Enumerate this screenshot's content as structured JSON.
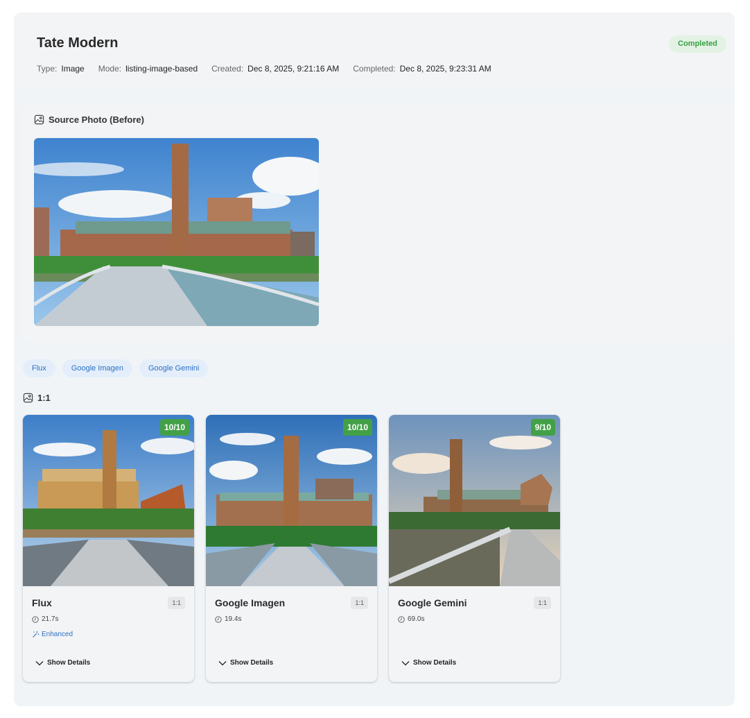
{
  "header": {
    "title": "Tate Modern",
    "status": "Completed",
    "meta": [
      {
        "key": "Type:",
        "value": "Image"
      },
      {
        "key": "Mode:",
        "value": "listing-image-based"
      },
      {
        "key": "Created:",
        "value": "Dec 8, 2025, 9:21:16 AM"
      },
      {
        "key": "Completed:",
        "value": "Dec 8, 2025, 9:23:31 AM"
      }
    ]
  },
  "source": {
    "title": "Source Photo (Before)"
  },
  "tabs": [
    "Flux",
    "Google Imagen",
    "Google Gemini"
  ],
  "ratio_group": {
    "label": "1:1"
  },
  "cards": [
    {
      "name": "Flux",
      "score": "10/10",
      "ratio": "1:1",
      "time": "21.7s",
      "enhanced": "Enhanced",
      "details": "Show Details"
    },
    {
      "name": "Google Imagen",
      "score": "10/10",
      "ratio": "1:1",
      "time": "19.4s",
      "details": "Show Details"
    },
    {
      "name": "Google Gemini",
      "score": "9/10",
      "ratio": "1:1",
      "time": "69.0s",
      "details": "Show Details"
    }
  ],
  "colors": {
    "status_bg": "#e3f2e4",
    "status_text": "#37a043",
    "tab_bg": "#e4eefb",
    "tab_text": "#2a6fc2",
    "score_bg": "#43a047"
  },
  "icons": {
    "section": "image-icon",
    "time": "clock-icon",
    "enhanced": "magic-wand-icon",
    "details": "chevron-down-icon"
  }
}
